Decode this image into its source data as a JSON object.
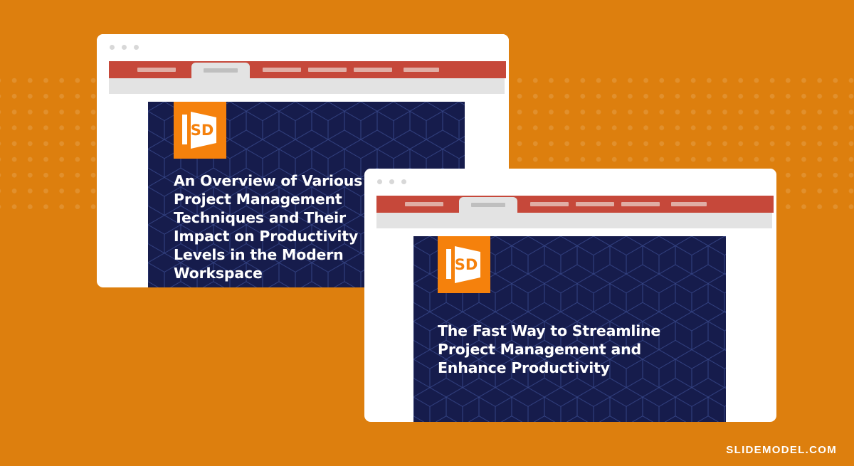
{
  "canvas": {
    "background_color": "#DD7F0E",
    "dot_pattern_color": "#E79433"
  },
  "windows": [
    {
      "id": "window-back",
      "chrome": {
        "traffic_lights": [
          "close-dot",
          "minimize-dot",
          "maximize-dot"
        ],
        "tab_bar_color": "#C6483A",
        "toolbar_color": "#E3E3E3",
        "tabs": [
          {
            "label": "",
            "active": false
          },
          {
            "label": "",
            "active": true
          },
          {
            "label": "",
            "active": false
          },
          {
            "label": "",
            "active": false
          },
          {
            "label": "",
            "active": false
          },
          {
            "label": "",
            "active": false
          }
        ]
      },
      "slide": {
        "background_color": "#161C4C",
        "logo": {
          "name": "slidemodel-sd-logo",
          "text": "SD",
          "color": "#F5810C"
        },
        "title": "An Overview of Various\nProject Management\nTechniques and Their\nImpact on Productivity\nLevels in the Modern\nWorkspace"
      }
    },
    {
      "id": "window-front",
      "chrome": {
        "traffic_lights": [
          "close-dot",
          "minimize-dot",
          "maximize-dot"
        ],
        "tab_bar_color": "#C6483A",
        "toolbar_color": "#E3E3E3",
        "tabs": [
          {
            "label": "",
            "active": false
          },
          {
            "label": "",
            "active": true
          },
          {
            "label": "",
            "active": false
          },
          {
            "label": "",
            "active": false
          },
          {
            "label": "",
            "active": false
          },
          {
            "label": "",
            "active": false
          }
        ]
      },
      "slide": {
        "background_color": "#161C4C",
        "logo": {
          "name": "slidemodel-sd-logo",
          "text": "SD",
          "color": "#F5810C"
        },
        "title": "The Fast Way to Streamline\nProject Management and\nEnhance Productivity"
      }
    }
  ],
  "watermark": {
    "text": "SLIDEMODEL.COM"
  }
}
